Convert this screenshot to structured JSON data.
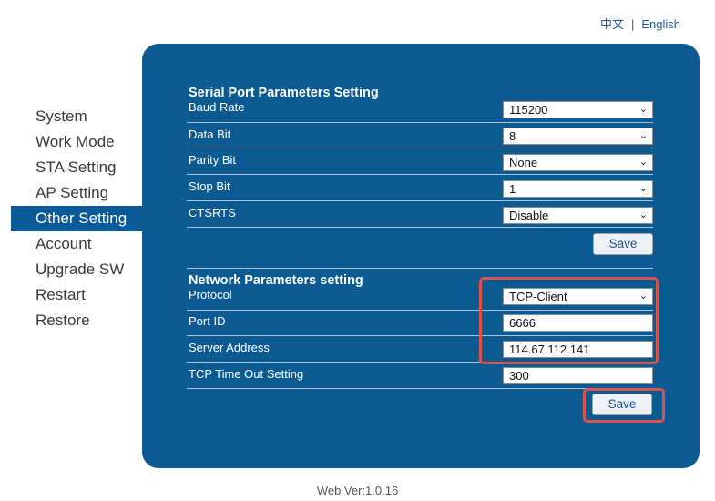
{
  "lang": {
    "zh": "中文",
    "separator": "|",
    "en": "English"
  },
  "sidebar": {
    "items": [
      {
        "label": "System"
      },
      {
        "label": "Work Mode"
      },
      {
        "label": "STA Setting"
      },
      {
        "label": "AP Setting"
      },
      {
        "label": "Other Setting",
        "active": true
      },
      {
        "label": "Account"
      },
      {
        "label": "Upgrade SW"
      },
      {
        "label": "Restart"
      },
      {
        "label": "Restore"
      }
    ]
  },
  "serial": {
    "title": "Serial Port Parameters Setting",
    "baud_label": "Baud Rate",
    "baud_value": "115200",
    "databit_label": "Data Bit",
    "databit_value": "8",
    "parity_label": "Parity Bit",
    "parity_value": "None",
    "stopbit_label": "Stop Bit",
    "stopbit_value": "1",
    "ctsrts_label": "CTSRTS",
    "ctsrts_value": "Disable",
    "save_label": "Save"
  },
  "network": {
    "title": "Network Parameters setting",
    "protocol_label": "Protocol",
    "protocol_value": "TCP-Client",
    "port_label": "Port ID",
    "port_value": "6666",
    "server_label": "Server Address",
    "server_value": "114.67.112.141",
    "timeout_label": "TCP Time Out Setting",
    "timeout_value": "300",
    "save_label": "Save"
  },
  "footer": {
    "version": "Web Ver:1.0.16"
  },
  "colors": {
    "panel": "#0b5b92",
    "active_item": "#0a5a9a",
    "highlight": "#d9534f"
  },
  "icons": {
    "select": "chevron-down-icon"
  }
}
